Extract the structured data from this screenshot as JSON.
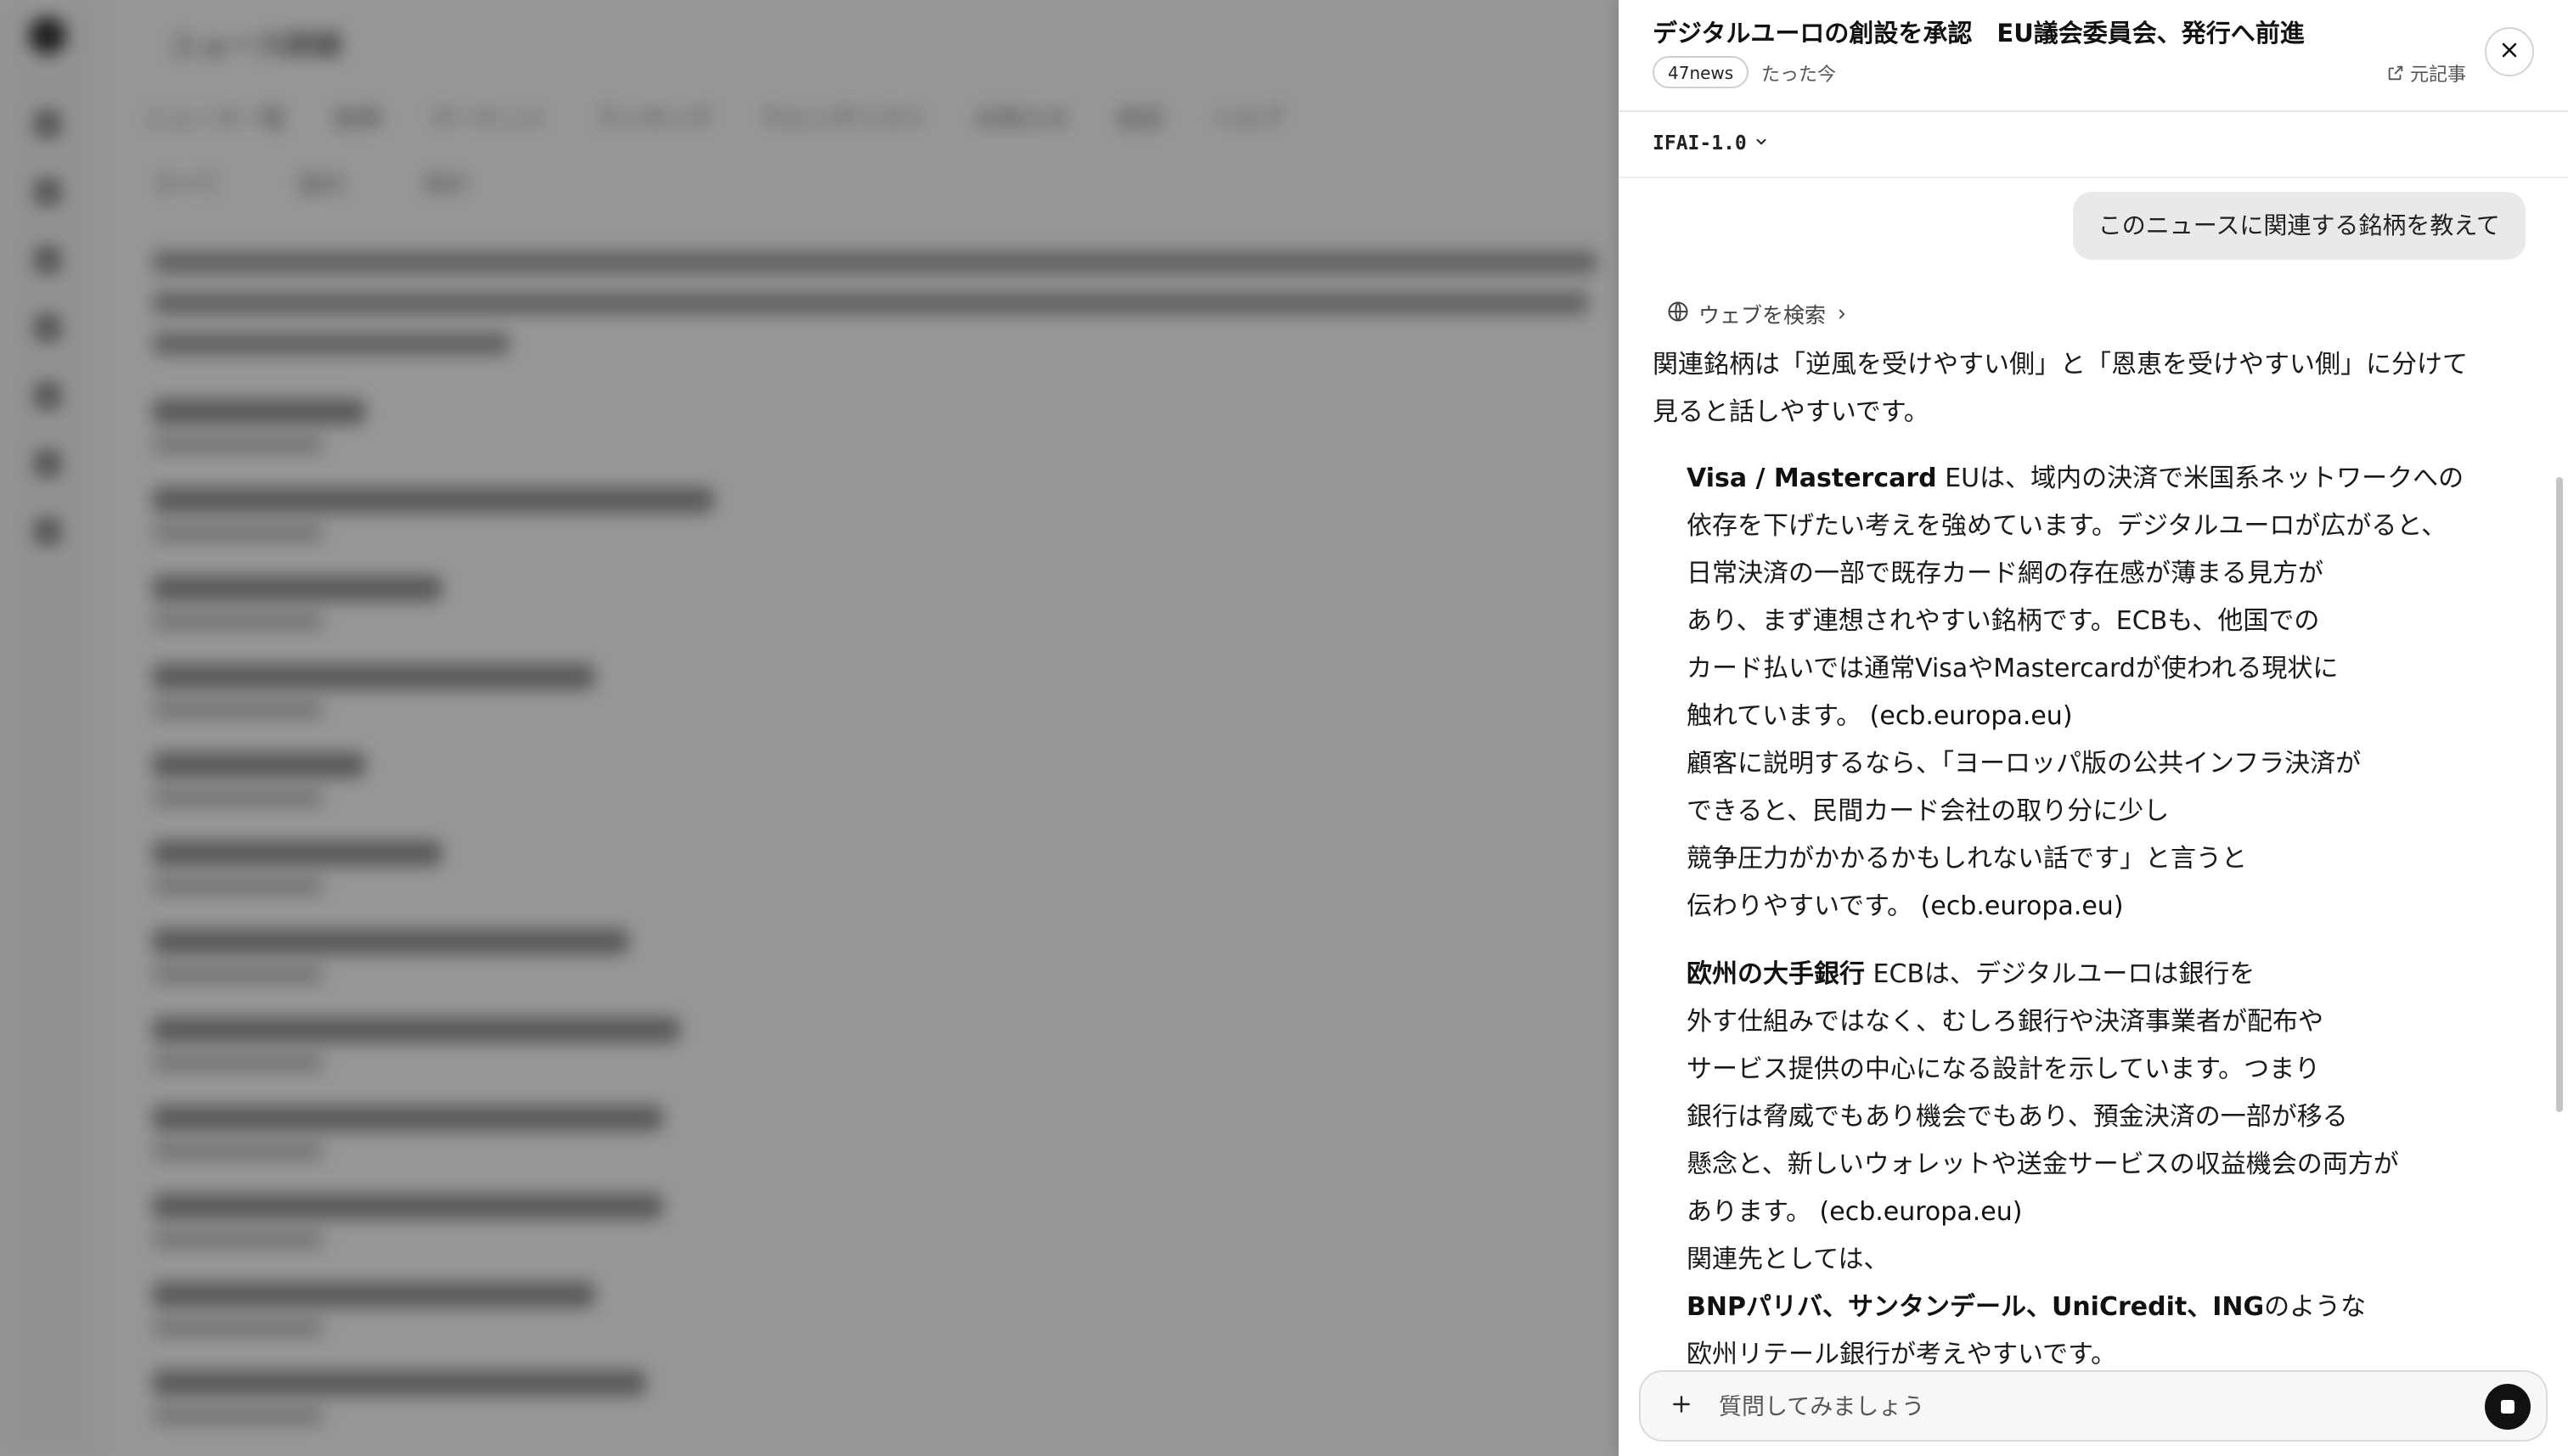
{
  "panel": {
    "headline": "デジタルユーロの創設を承認　EU議会委員会、発行へ前進",
    "source": "47news",
    "timestamp": "たった今",
    "original_article_label": "元記事"
  },
  "model": {
    "selected": "IFAI-1.0"
  },
  "chat": {
    "user_message": "このニュースに関連する銘柄を教えて",
    "web_search_label": "ウェブを検索",
    "intro_lines": [
      "関連銘柄は「逆風を受けやすい側」と「恩恵を受けやすい側」に分けて",
      "見ると話しやすいです。"
    ],
    "block1": {
      "heading": "Visa / Mastercard",
      "first_line_rest": " EUは、域内の決済で米国系ネットワークへの",
      "lines": [
        "依存を下げたい考えを強めています。デジタルユーロが広がると、",
        "日常決済の一部で既存カード網の存在感が薄まる見方が",
        "あり、まず連想されやすい銘柄です。ECBも、他国での",
        "カード払いでは通常VisaやMastercardが使われる現状に"
      ],
      "cite_line_text": "触れています。",
      "citation": "(ecb.europa.eu)",
      "lines2": [
        "顧客に説明するなら、「ヨーロッパ版の公共インフラ決済が",
        "できると、民間カード会社の取り分に少し",
        "競争圧力がかかるかもしれない話です」と言うと"
      ],
      "cite_line2_text": "伝わりやすいです。",
      "citation2": "(ecb.europa.eu)"
    },
    "block2": {
      "heading": "欧州の大手銀行",
      "first_line_rest": " ECBは、デジタルユーロは銀行を",
      "lines": [
        "外す仕組みではなく、むしろ銀行や決済事業者が配布や",
        "サービス提供の中心になる設計を示しています。つまり",
        "銀行は脅威でもあり機会でもあり、預金決済の一部が移る",
        "懸念と、新しいウォレットや送金サービスの収益機会の両方が"
      ],
      "cite_line_text": "あります。",
      "citation": "(ecb.europa.eu)",
      "related_intro": "関連先としては、",
      "banks_bold": "BNPパリバ、サンタンデール、UniCredit、ING",
      "banks_rest": "のような",
      "last_line": "欧州リテール銀行が考えやすいです。"
    }
  },
  "composer": {
    "placeholder": "質問してみましょう"
  },
  "background": {
    "title": "ニュース詳細",
    "tabs": [
      "ニュース一覧",
      "銘柄",
      "マーケット",
      "ランキング",
      "ウォッチリスト",
      "お知らせ",
      "設定",
      "ヘルプ"
    ],
    "subtabs": [
      "すべて",
      "国内",
      "海外"
    ]
  },
  "colors": {
    "accent": "#111111",
    "overlay": "rgba(0,0,0,0.38)",
    "user_bubble": "#e9e9e9"
  }
}
